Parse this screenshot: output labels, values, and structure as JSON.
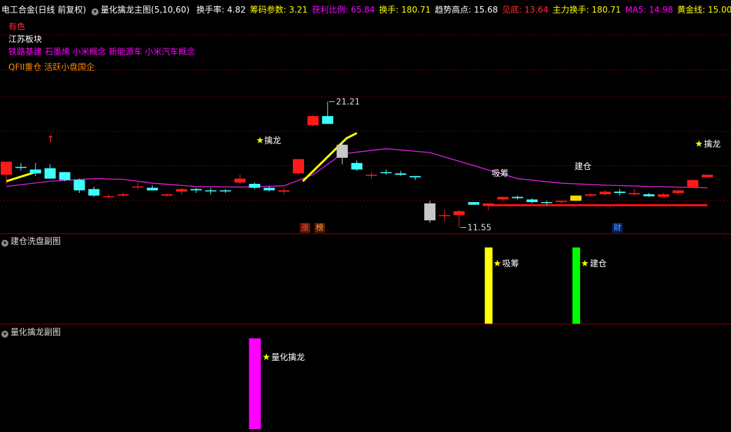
{
  "header": {
    "stock_name": "电工合金(日线 前复权)",
    "indicator_name": "量化擒龙主图(5,10,60)",
    "metrics": [
      {
        "label": "换手率:",
        "value": "4.82",
        "color": "#ffffff"
      },
      {
        "label": "筹码参数:",
        "value": "3.21",
        "color": "#ffff00"
      },
      {
        "label": "获利比例:",
        "value": "65.84",
        "color": "#ff00ff"
      },
      {
        "label": "换手:",
        "value": "180.71",
        "color": "#ffff00"
      },
      {
        "label": "趋势高点:",
        "value": "15.68",
        "color": "#ffffff"
      },
      {
        "label": "见底:",
        "value": "13.64",
        "color": "#ff3030"
      },
      {
        "label": "主力换手:",
        "value": "180.71",
        "color": "#ffff00"
      },
      {
        "label": "MA5:",
        "value": "14.98",
        "color": "#ff00ff"
      },
      {
        "label": "黄金线:",
        "value": "15.00",
        "color": "#ffff00"
      }
    ]
  },
  "info_lines": [
    {
      "text": "有色",
      "color": "#ff3030"
    },
    {
      "text": "江苏板块",
      "color": "#ffffff"
    },
    {
      "text": "铁路基建 石墨烯 小米概念 新能源车 小米汽车概念",
      "color": "#ff00ff"
    },
    {
      "text": "QFII重仓 活跃小盘国企",
      "color": "#ff8c00"
    }
  ],
  "main_chart": {
    "markers": {
      "qinlong_left": "擒龙",
      "qinlong_right": "擒龙",
      "xichou": "吸筹",
      "jiancang": "建仓",
      "high_label": "21.21",
      "low_label": "11.55",
      "event_zhang": "涨",
      "event_bang": "榜",
      "event_cai": "财"
    }
  },
  "sub_panel_1": {
    "title": "建仓洗盘副图",
    "signals": [
      "吸筹",
      "建仓"
    ]
  },
  "sub_panel_2": {
    "title": "量化擒龙副图",
    "signals": [
      "量化擒龙"
    ]
  },
  "chart_data": {
    "type": "candlestick",
    "price_range": [
      11.55,
      21.21
    ],
    "candles": [
      {
        "o": 15.6,
        "h": 16.4,
        "l": 14.9,
        "c": 16.6,
        "col": "red"
      },
      {
        "o": 16.2,
        "h": 16.5,
        "l": 15.9,
        "c": 16.2,
        "col": "cyan"
      },
      {
        "o": 16.0,
        "h": 16.5,
        "l": 15.5,
        "c": 15.7,
        "col": "cyan"
      },
      {
        "o": 16.1,
        "h": 16.4,
        "l": 15.3,
        "c": 15.3,
        "col": "cyan"
      },
      {
        "o": 15.8,
        "h": 15.8,
        "l": 15.1,
        "c": 15.2,
        "col": "cyan"
      },
      {
        "o": 15.2,
        "h": 15.3,
        "l": 14.2,
        "c": 14.4,
        "col": "cyan"
      },
      {
        "o": 14.5,
        "h": 14.7,
        "l": 13.9,
        "c": 14.0,
        "col": "cyan"
      },
      {
        "o": 13.9,
        "h": 14.1,
        "l": 13.8,
        "c": 13.95,
        "col": "red"
      },
      {
        "o": 14.0,
        "h": 14.2,
        "l": 13.9,
        "c": 14.1,
        "col": "red"
      },
      {
        "o": 14.7,
        "h": 15.0,
        "l": 14.5,
        "c": 14.7,
        "col": "red"
      },
      {
        "o": 14.6,
        "h": 14.8,
        "l": 14.4,
        "c": 14.4,
        "col": "cyan"
      },
      {
        "o": 14.0,
        "h": 14.1,
        "l": 13.9,
        "c": 14.1,
        "col": "red"
      },
      {
        "o": 14.3,
        "h": 14.6,
        "l": 14.1,
        "c": 14.5,
        "col": "red"
      },
      {
        "o": 14.5,
        "h": 14.6,
        "l": 14.2,
        "c": 14.4,
        "col": "cyan"
      },
      {
        "o": 14.4,
        "h": 14.6,
        "l": 14.1,
        "c": 14.4,
        "col": "cyan"
      },
      {
        "o": 14.4,
        "h": 14.5,
        "l": 14.2,
        "c": 14.4,
        "col": "cyan"
      },
      {
        "o": 15.0,
        "h": 15.6,
        "l": 14.9,
        "c": 15.3,
        "col": "red"
      },
      {
        "o": 14.9,
        "h": 15.0,
        "l": 14.5,
        "c": 14.6,
        "col": "cyan"
      },
      {
        "o": 14.6,
        "h": 14.7,
        "l": 14.3,
        "c": 14.4,
        "col": "cyan"
      },
      {
        "o": 14.3,
        "h": 14.6,
        "l": 14.1,
        "c": 14.4,
        "col": "red"
      },
      {
        "o": 15.7,
        "h": 16.8,
        "l": 15.6,
        "c": 16.8,
        "col": "red"
      },
      {
        "o": 19.4,
        "h": 20.2,
        "l": 19.3,
        "c": 20.1,
        "col": "red"
      },
      {
        "o": 20.1,
        "h": 21.21,
        "l": 19.5,
        "c": 19.5,
        "col": "cyan"
      },
      {
        "o": 17.9,
        "h": 18.2,
        "l": 16.4,
        "c": 16.9,
        "col": "white"
      },
      {
        "o": 16.5,
        "h": 16.7,
        "l": 15.9,
        "c": 16.0,
        "col": "cyan"
      },
      {
        "o": 15.6,
        "h": 15.8,
        "l": 15.3,
        "c": 15.6,
        "col": "red"
      },
      {
        "o": 15.8,
        "h": 16.0,
        "l": 15.6,
        "c": 15.8,
        "col": "cyan"
      },
      {
        "o": 15.7,
        "h": 15.9,
        "l": 15.5,
        "c": 15.6,
        "col": "cyan"
      },
      {
        "o": 15.5,
        "h": 15.5,
        "l": 15.2,
        "c": 15.4,
        "col": "cyan"
      },
      {
        "o": 13.4,
        "h": 13.6,
        "l": 11.9,
        "c": 12.1,
        "col": "white"
      },
      {
        "o": 12.5,
        "h": 12.9,
        "l": 12.0,
        "c": 12.5,
        "col": "red"
      },
      {
        "o": 12.5,
        "h": 12.9,
        "l": 11.55,
        "c": 12.8,
        "col": "red"
      },
      {
        "o": 13.5,
        "h": 13.5,
        "l": 13.3,
        "c": 13.3,
        "col": "cyan"
      },
      {
        "o": 13.2,
        "h": 13.4,
        "l": 12.9,
        "c": 13.4,
        "col": "red"
      },
      {
        "o": 13.7,
        "h": 13.9,
        "l": 13.6,
        "c": 13.9,
        "col": "red"
      },
      {
        "o": 13.9,
        "h": 14.0,
        "l": 13.7,
        "c": 13.8,
        "col": "cyan"
      },
      {
        "o": 13.7,
        "h": 13.8,
        "l": 13.4,
        "c": 13.5,
        "col": "cyan"
      },
      {
        "o": 13.5,
        "h": 13.6,
        "l": 13.3,
        "c": 13.5,
        "col": "cyan"
      },
      {
        "o": 13.5,
        "h": 13.6,
        "l": 13.4,
        "c": 13.6,
        "col": "red"
      },
      {
        "o": 13.6,
        "h": 14.0,
        "l": 13.6,
        "c": 14.0,
        "col": "yellow"
      },
      {
        "o": 14.0,
        "h": 14.2,
        "l": 13.9,
        "c": 14.1,
        "col": "red"
      },
      {
        "o": 14.1,
        "h": 14.4,
        "l": 14.0,
        "c": 14.3,
        "col": "red"
      },
      {
        "o": 14.3,
        "h": 14.5,
        "l": 14.0,
        "c": 14.2,
        "col": "cyan"
      },
      {
        "o": 14.1,
        "h": 14.5,
        "l": 14.0,
        "c": 14.2,
        "col": "red"
      },
      {
        "o": 14.1,
        "h": 14.2,
        "l": 13.9,
        "c": 13.95,
        "col": "cyan"
      },
      {
        "o": 13.9,
        "h": 14.2,
        "l": 13.9,
        "c": 14.1,
        "col": "red"
      },
      {
        "o": 14.2,
        "h": 14.4,
        "l": 14.1,
        "c": 14.4,
        "col": "red"
      },
      {
        "o": 14.6,
        "h": 15.2,
        "l": 14.6,
        "c": 15.2,
        "col": "red"
      },
      {
        "o": 15.4,
        "h": 15.6,
        "l": 15.4,
        "c": 15.6,
        "col": "red"
      }
    ],
    "ma": [
      {
        "x": 0,
        "y": 14.7
      },
      {
        "x": 3,
        "y": 15.1
      },
      {
        "x": 6,
        "y": 15.3
      },
      {
        "x": 8,
        "y": 15.25
      },
      {
        "x": 10,
        "y": 14.95
      },
      {
        "x": 13,
        "y": 14.7
      },
      {
        "x": 16,
        "y": 14.65
      },
      {
        "x": 19,
        "y": 14.75
      },
      {
        "x": 21,
        "y": 15.6
      },
      {
        "x": 23,
        "y": 17.2
      },
      {
        "x": 26,
        "y": 17.6
      },
      {
        "x": 29,
        "y": 17.3
      },
      {
        "x": 32,
        "y": 16.3
      },
      {
        "x": 35,
        "y": 15.3
      },
      {
        "x": 38,
        "y": 14.95
      },
      {
        "x": 41,
        "y": 14.8
      },
      {
        "x": 44,
        "y": 14.7
      },
      {
        "x": 48,
        "y": 14.6
      }
    ],
    "yellow_line": [
      {
        "x": 0,
        "y": 15.1
      },
      {
        "x": 2,
        "y": 15.8
      },
      {
        "x": 20.3,
        "y": 15.1
      },
      {
        "x": 23.3,
        "y": 18.4
      },
      {
        "x": 24,
        "y": 18.8
      }
    ],
    "red_level": {
      "from": 33,
      "to": 48,
      "y": 13.26
    },
    "sub1_bars": [
      {
        "index": 33,
        "label": "吸筹",
        "color": "#ffff00"
      },
      {
        "index": 39,
        "label": "建仓",
        "color": "#00ff00"
      }
    ],
    "sub2_bars": [
      {
        "index": 17,
        "label": "量化擒龙",
        "color": "#ff00ff"
      }
    ]
  }
}
